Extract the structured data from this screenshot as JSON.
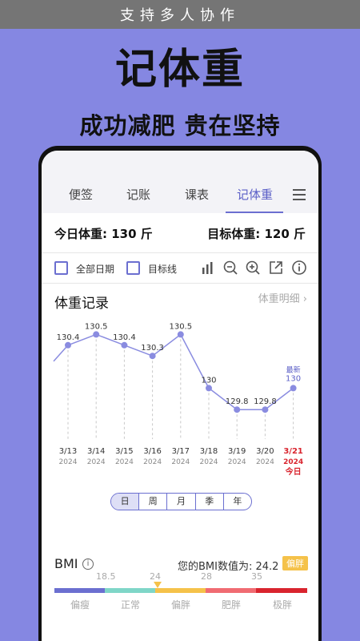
{
  "banner": {
    "text": "支持多人协作"
  },
  "hero": {
    "title": "记体重",
    "subtitle": "成功减肥 贵在坚持"
  },
  "tabs": [
    {
      "label": "便签",
      "active": false
    },
    {
      "label": "记账",
      "active": false
    },
    {
      "label": "课表",
      "active": false
    },
    {
      "label": "记体重",
      "active": true
    }
  ],
  "weights": {
    "today": "今日体重: 130 斤",
    "target": "目标体重: 120 斤"
  },
  "options": {
    "all_dates": "全部日期",
    "target_line": "目标线"
  },
  "toolbar_icons": [
    "bar-chart-icon",
    "zoom-out-icon",
    "zoom-in-icon",
    "export-icon",
    "info-icon"
  ],
  "section": {
    "title": "体重记录",
    "detail_link": "体重明细",
    "detail_chevron": "›"
  },
  "chart_data": {
    "type": "line",
    "points": [
      {
        "date": "3/13",
        "year": "2024",
        "value": 130.4
      },
      {
        "date": "3/14",
        "year": "2024",
        "value": 130.5
      },
      {
        "date": "3/15",
        "year": "2024",
        "value": 130.4
      },
      {
        "date": "3/16",
        "year": "2024",
        "value": 130.3
      },
      {
        "date": "3/17",
        "year": "2024",
        "value": 130.5
      },
      {
        "date": "3/18",
        "year": "2024",
        "value": 130
      },
      {
        "date": "3/19",
        "year": "2024",
        "value": 129.8
      },
      {
        "date": "3/20",
        "year": "2024",
        "value": 129.8
      },
      {
        "date": "3/21",
        "year": "2024",
        "value": 130,
        "today": true
      }
    ],
    "latest_label": "最新",
    "today_label": "今日",
    "line_color": "#8a8ce0",
    "today_color": "#d9242e",
    "ylim": [
      129.6,
      130.6
    ]
  },
  "periods": [
    {
      "label": "日",
      "selected": true
    },
    {
      "label": "周",
      "selected": false
    },
    {
      "label": "月",
      "selected": false
    },
    {
      "label": "季",
      "selected": false
    },
    {
      "label": "年",
      "selected": false
    }
  ],
  "bmi": {
    "title": "BMI",
    "info_icon": "info-icon",
    "value_text": "您的BMI数值为: 24.2",
    "badge": "偏胖",
    "badge_color": "#f5c24a",
    "ticks": [
      "18.5",
      "24",
      "28",
      "35"
    ],
    "categories": [
      {
        "label": "偏瘦",
        "color": "#6b6fd0"
      },
      {
        "label": "正常",
        "color": "#7fd6c8"
      },
      {
        "label": "偏胖",
        "color": "#f5c24a"
      },
      {
        "label": "肥胖",
        "color": "#f06b72"
      },
      {
        "label": "极胖",
        "color": "#d9242e"
      }
    ]
  }
}
